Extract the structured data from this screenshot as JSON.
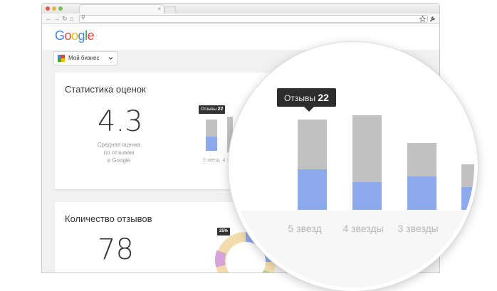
{
  "browser": {
    "tab_close": "×",
    "nav": {
      "back": "←",
      "forward": "→",
      "reload": "↻",
      "home": "⌂",
      "search": "⚲"
    },
    "icons": [
      "back-arrow-icon",
      "forward-arrow-icon",
      "reload-icon",
      "home-icon",
      "search-icon",
      "star-icon",
      "wrench-icon"
    ],
    "traffic_colors": [
      "#e0584f",
      "#e4b544",
      "#78c04f"
    ]
  },
  "google_logo": {
    "letters": [
      "G",
      "o",
      "o",
      "g",
      "l",
      "e"
    ],
    "colors": [
      "#4285f4",
      "#ea4335",
      "#fbbc05",
      "#4285f4",
      "#34a853",
      "#ea4335"
    ]
  },
  "business_selector": {
    "label": "Мой бизнес",
    "icon": "business-icon",
    "chevron": "chevron-down-icon"
  },
  "ratings_card": {
    "title": "Статистика оценок",
    "average": "4.3",
    "avg_caption_1": "Средняя оценка",
    "avg_caption_2": "по отзывам",
    "avg_caption_3": "в Google",
    "tooltip_label": "Отзывы",
    "tooltip_value": "22",
    "axis_label": "5 звезд  4 з"
  },
  "reviews_card": {
    "title": "Количество отзывов",
    "count": "78",
    "donut_tooltip": "25%"
  },
  "magnifier": {
    "tooltip_label": "Отзывы",
    "tooltip_value": "22",
    "chart_data": {
      "type": "bar",
      "categories": [
        "5 звезд",
        "4 звезды",
        "3 звезды"
      ],
      "series": [
        {
          "color": "#8ca9ec",
          "values": [
            22,
            15,
            18
          ]
        },
        {
          "color": "#c1c1c1",
          "values": [
            27,
            36,
            18
          ]
        }
      ]
    }
  },
  "colors": {
    "accent_blue": "#8ca9ec",
    "bar_grey": "#c1c1c1",
    "tooltip_bg": "#2d2d2d"
  }
}
